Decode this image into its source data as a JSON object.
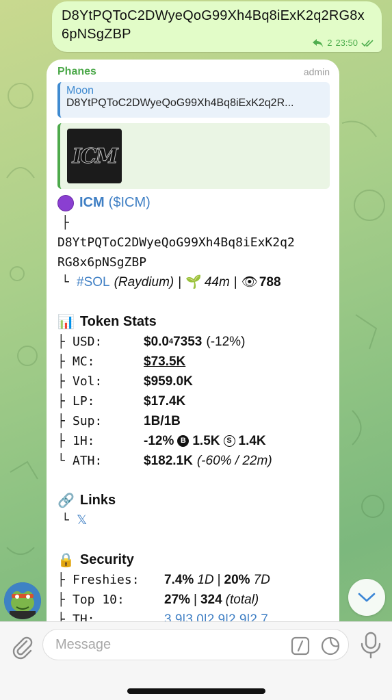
{
  "outgoing": {
    "text": "D8YtPQToC2DWyeQoG99Xh4Bq8iExK2q2RG8x6pNSgZBP",
    "reply_count": "2",
    "time": "23:50"
  },
  "incoming": {
    "sender": "Phanes",
    "role": "admin",
    "reply": {
      "title": "Moon",
      "text": "D8YtPQToC2DWyeQoG99Xh4Bq8iExK2q2R..."
    },
    "thumb_text": "ICM",
    "token_name": "ICM",
    "token_ticker": "($ICM)",
    "tree_top": "├",
    "address_line1": "D8YtPQToC2DWyeQoG99Xh4Bq8iExK2q2",
    "address_line2": "RG8x6pNSgZBP",
    "chain_tag": "#SOL",
    "dex": "(Raydium)",
    "age": "44m",
    "views": "788",
    "sep": "|",
    "stats_title": "Token Stats",
    "stats": [
      {
        "tree": "├",
        "label": "USD:",
        "value": "$0.0",
        "sub": "4",
        "value2": "7353",
        "extra": "(-12%)"
      },
      {
        "tree": "├",
        "label": "MC:",
        "value": "$73.5K"
      },
      {
        "tree": "├",
        "label": "Vol:",
        "value": "$959.0K"
      },
      {
        "tree": "├",
        "label": "LP:",
        "value": "$17.4K"
      },
      {
        "tree": "├",
        "label": "Sup:",
        "value": "1B/1B"
      },
      {
        "tree": "├",
        "label": "1H:",
        "value": "-12%",
        "b_value": "1.5K",
        "s_value": "1.4K"
      },
      {
        "tree": "└",
        "label": "ATH:",
        "value": "$182.1K",
        "extra": "(-60% / 22m)"
      }
    ],
    "links_title": "Links",
    "links_tree": "└",
    "x_link": "𝕏",
    "security_title": "Security",
    "security": [
      {
        "tree": "├",
        "label": "Freshies:",
        "v1": "7.4%",
        "i1": "1D",
        "v2": "20%",
        "i2": "7D"
      },
      {
        "tree": "├",
        "label": "Top 10:",
        "v1": "27%",
        "v2": "324",
        "i2": "(total)"
      },
      {
        "tree": "├",
        "label": "TH:",
        "v1": "3.9|3.0|2.9|2.9|2.7"
      }
    ]
  },
  "input": {
    "placeholder": "Message"
  },
  "colors": {
    "accent_green": "#4da94b",
    "link_blue": "#3f7fc4",
    "bubble_out": "#e2fcc8"
  }
}
